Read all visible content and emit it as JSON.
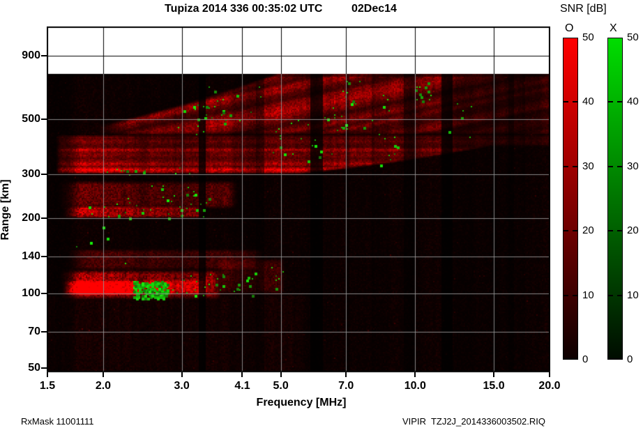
{
  "header": {
    "title": "Tupiza 2014 336 00:35:02 UTC",
    "date": "02Dec14"
  },
  "footer": {
    "left": "RxMask 11001111",
    "right": "VIPIR  TZJ2J_2014336003502.RIQ"
  },
  "colorbars": {
    "title": "SNR [dB]",
    "ticks": [
      0,
      10,
      20,
      30,
      40,
      50
    ],
    "bars": [
      {
        "id": "o",
        "label": "O",
        "color_top": "#ff0000",
        "color_bottom": "#0c0000"
      },
      {
        "id": "x",
        "label": "X",
        "color_top": "#00dd00",
        "color_bottom": "#000c00"
      }
    ]
  },
  "chart_data": {
    "type": "heatmap",
    "title": "Tupiza 2014 336 00:35:02 UTC",
    "date_label": "02Dec14",
    "xlabel": "Frequency [MHz]",
    "ylabel": "Range [km]",
    "x_scale": "log",
    "y_scale": "log",
    "xlim": [
      1.5,
      20.0
    ],
    "ylim": [
      50,
      1180
    ],
    "x_ticks": [
      1.5,
      2.0,
      3.0,
      4.1,
      5.0,
      7.0,
      10.0,
      15.0,
      20.0
    ],
    "y_ticks": [
      50,
      70,
      100,
      140,
      200,
      300,
      500,
      900
    ],
    "grid": true,
    "snr_scale_db": [
      0,
      50
    ],
    "data_top_km": 758,
    "o_mode_color": "#ff0000",
    "x_mode_color": "#00cc00",
    "amp_scale": "fraction of 50 dB SNR",
    "echo_regions": [
      {
        "kind": "band",
        "f0": 1.58,
        "f1": 3.7,
        "r0": 93,
        "r1": 124,
        "amp": 0.55,
        "note": "E-region echo band"
      },
      {
        "kind": "band",
        "f0": 1.62,
        "f1": 2.45,
        "r0": 97,
        "r1": 112,
        "amp": 0.95,
        "note": "E-region saturated core"
      },
      {
        "kind": "band",
        "f0": 2.4,
        "f1": 3.45,
        "r0": 98,
        "r1": 113,
        "amp": 0.7,
        "note": "E-region core continuation"
      },
      {
        "kind": "band",
        "f0": 3.55,
        "f1": 5.1,
        "r0": 96,
        "r1": 138,
        "amp": 0.17,
        "note": "E-region weak tail"
      },
      {
        "kind": "band",
        "f0": 1.62,
        "f1": 4.6,
        "r0": 122,
        "r1": 150,
        "amp": 0.2,
        "note": "diffuse above E"
      },
      {
        "kind": "band",
        "f0": 1.56,
        "f1": 4.02,
        "r0": 216,
        "r1": 284,
        "amp": 0.28,
        "note": "second-hop diffuse band"
      },
      {
        "kind": "band",
        "f0": 1.6,
        "f1": 3.4,
        "r0": 200,
        "r1": 224,
        "amp": 0.58,
        "note": "second-hop bright edge"
      },
      {
        "kind": "streaks",
        "f0": 1.56,
        "f1": 20.0,
        "r0": 298,
        "r1": 434,
        "amp": 0.6,
        "note": "F-region layered echoes"
      },
      {
        "kind": "diag",
        "f0": 1.9,
        "f1": 20.0,
        "r0": 428,
        "r1": 762,
        "amp": 0.36,
        "note": "spread-F rising traces"
      }
    ],
    "interference_bands": [
      {
        "f0": 3.28,
        "f1": 3.4,
        "depth": 0.85
      },
      {
        "f0": 4.4,
        "f1": 4.58,
        "depth": 0.5
      },
      {
        "f0": 5.8,
        "f1": 6.2,
        "depth": 0.78
      },
      {
        "f0": 7.02,
        "f1": 7.12,
        "depth": 0.35
      },
      {
        "f0": 8.0,
        "f1": 8.12,
        "depth": 0.3
      },
      {
        "f0": 9.4,
        "f1": 9.95,
        "depth": 0.6
      },
      {
        "f0": 11.4,
        "f1": 12.15,
        "depth": 0.78
      },
      {
        "f0": 14.9,
        "f1": 15.12,
        "depth": 0.35
      },
      {
        "f0": 16.2,
        "f1": 16.6,
        "depth": 0.5
      },
      {
        "f0": 17.3,
        "f1": 17.55,
        "depth": 0.35
      }
    ],
    "enhanced_bands": [
      {
        "f0": 1.62,
        "f1": 2.4,
        "gain": 1.15
      },
      {
        "f0": 5.45,
        "f1": 5.8,
        "gain": 1.1
      },
      {
        "f0": 6.2,
        "f1": 6.95,
        "gain": 1.25
      },
      {
        "f0": 7.3,
        "f1": 8.0,
        "gain": 1.15
      },
      {
        "f0": 8.5,
        "f1": 9.35,
        "gain": 1.05
      },
      {
        "f0": 10.25,
        "f1": 11.35,
        "gain": 1.2
      },
      {
        "f0": 12.3,
        "f1": 13.4,
        "gain": 1.05
      },
      {
        "f0": 18.9,
        "f1": 20.0,
        "gain": 1.15
      }
    ],
    "freq_envelope": [
      [
        1.5,
        0.85
      ],
      [
        1.8,
        1.0
      ],
      [
        8.3,
        1.0
      ],
      [
        9.0,
        0.8
      ],
      [
        10.0,
        0.7
      ],
      [
        11.3,
        0.68
      ],
      [
        12.0,
        0.58
      ],
      [
        13.5,
        0.52
      ],
      [
        14.5,
        0.45
      ],
      [
        16.0,
        0.4
      ],
      [
        17.0,
        0.3
      ],
      [
        18.5,
        0.28
      ],
      [
        20.0,
        0.42
      ]
    ],
    "x_mode_clusters": [
      {
        "f0": 2.33,
        "f1": 2.78,
        "r0": 95,
        "r1": 111,
        "n": 150,
        "solid": true
      },
      {
        "f0": 2.7,
        "f1": 4.3,
        "r0": 97,
        "r1": 120,
        "n": 26
      },
      {
        "f0": 4.3,
        "f1": 5.2,
        "r0": 100,
        "r1": 132,
        "n": 8
      },
      {
        "f0": 1.85,
        "f1": 3.35,
        "r0": 202,
        "r1": 230,
        "n": 26
      },
      {
        "f0": 2.25,
        "f1": 3.6,
        "r0": 228,
        "r1": 272,
        "n": 16
      },
      {
        "f0": 1.95,
        "f1": 3.2,
        "r0": 300,
        "r1": 320,
        "n": 14
      },
      {
        "f0": 2.9,
        "f1": 4.35,
        "r0": 430,
        "r1": 590,
        "n": 24
      },
      {
        "f0": 4.55,
        "f1": 6.6,
        "r0": 340,
        "r1": 570,
        "n": 24
      },
      {
        "f0": 6.6,
        "f1": 8.7,
        "r0": 380,
        "r1": 650,
        "n": 18
      },
      {
        "f0": 8.3,
        "f1": 9.3,
        "r0": 330,
        "r1": 440,
        "n": 8
      },
      {
        "f0": 9.9,
        "f1": 10.9,
        "r0": 580,
        "r1": 710,
        "n": 12
      },
      {
        "f0": 6.8,
        "f1": 7.5,
        "r0": 640,
        "r1": 720,
        "n": 5
      },
      {
        "f0": 3.4,
        "f1": 4.5,
        "r0": 590,
        "r1": 700,
        "n": 8
      },
      {
        "f0": 11.5,
        "f1": 13.6,
        "r0": 420,
        "r1": 640,
        "n": 6
      },
      {
        "f0": 1.6,
        "f1": 2.3,
        "r0": 120,
        "r1": 210,
        "n": 5
      }
    ]
  }
}
